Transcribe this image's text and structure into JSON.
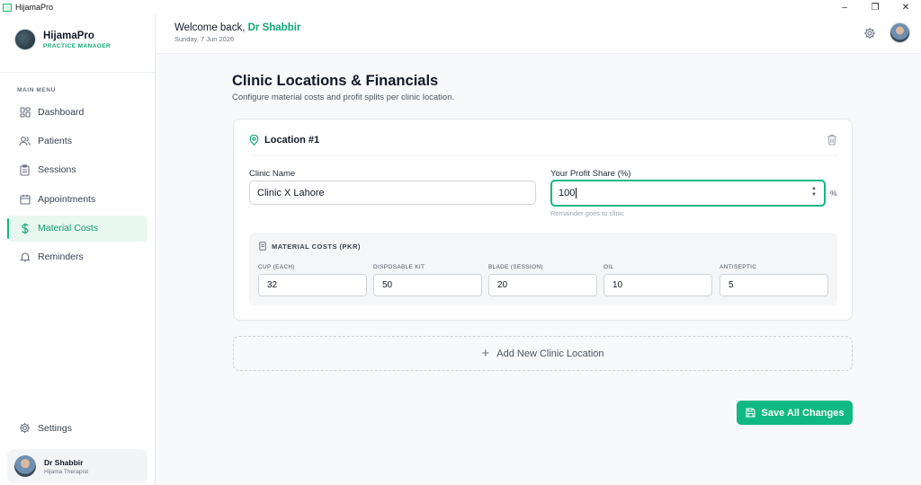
{
  "window": {
    "title": "HijamaPro"
  },
  "brand": {
    "name": "HijamaPro",
    "tagline": "PRACTICE MANAGER"
  },
  "sidebar": {
    "heading": "MAIN MENU",
    "items": [
      {
        "label": "Dashboard",
        "icon": "grid-icon"
      },
      {
        "label": "Patients",
        "icon": "users-icon"
      },
      {
        "label": "Sessions",
        "icon": "clipboard-icon"
      },
      {
        "label": "Appointments",
        "icon": "calendar-icon"
      },
      {
        "label": "Material Costs",
        "icon": "dollar-icon",
        "active": true
      },
      {
        "label": "Reminders",
        "icon": "bell-icon"
      }
    ],
    "settings_label": "Settings",
    "user": {
      "name": "Dr Shabbir",
      "role": "Hijama Therapist"
    }
  },
  "header": {
    "welcome_prefix": "Welcome back,",
    "user_name": "Dr Shabbir",
    "date": "Sunday, 7 Jun 2026"
  },
  "page": {
    "title": "Clinic Locations & Financials",
    "subtitle": "Configure material costs and profit splits per clinic location."
  },
  "location": {
    "title": "Location #1",
    "clinic_name_label": "Clinic Name",
    "clinic_name_value": "Clinic X Lahore",
    "profit_label": "Your Profit Share (%)",
    "profit_value": "100",
    "percent_symbol": "%",
    "profit_hint": "Remainder goes to clinic",
    "materials_heading": "MATERIAL COSTS (PKR)",
    "materials": [
      {
        "label": "CUP (EACH)",
        "value": "32"
      },
      {
        "label": "DISPOSABLE KIT",
        "value": "50"
      },
      {
        "label": "BLADE (SESSION)",
        "value": "20"
      },
      {
        "label": "OIL",
        "value": "10"
      },
      {
        "label": "ANTISEPTIC",
        "value": "5"
      }
    ]
  },
  "actions": {
    "add_location": "Add New Clinic Location",
    "save": "Save All Changes"
  },
  "colors": {
    "accent": "#10b981",
    "accent_text": "#10a873",
    "active_bg": "#e9f7f1"
  }
}
